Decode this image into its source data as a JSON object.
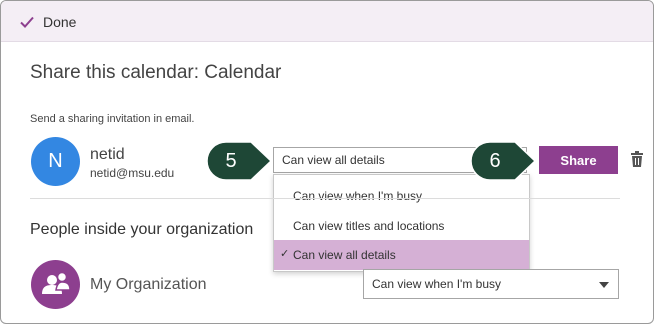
{
  "topbar": {
    "done_label": "Done"
  },
  "dialog": {
    "title": "Share this calendar: Calendar",
    "invite_text": "Send a sharing invitation in email."
  },
  "recipient": {
    "avatar_initial": "N",
    "name": "netid",
    "email": "netid@msu.edu",
    "permission_value": "Can view all details"
  },
  "permission_options": [
    {
      "label": "Can view when I'm busy",
      "selected": false
    },
    {
      "label": "Can view titles and locations",
      "selected": false
    },
    {
      "label": "Can view all details",
      "selected": true
    }
  ],
  "share_label": "Share",
  "people_section": {
    "heading": "People inside your organization",
    "org_name": "My Organization",
    "org_permission_value": "Can view when I'm busy"
  },
  "callouts": [
    "5",
    "6"
  ],
  "colors": {
    "accent_purple": "#8d3f8f",
    "selected_option_bg": "#d5b0d5",
    "topbar_bg": "#f4eef5",
    "avatar_blue": "#3387e2",
    "callout_green": "#1e4736"
  }
}
